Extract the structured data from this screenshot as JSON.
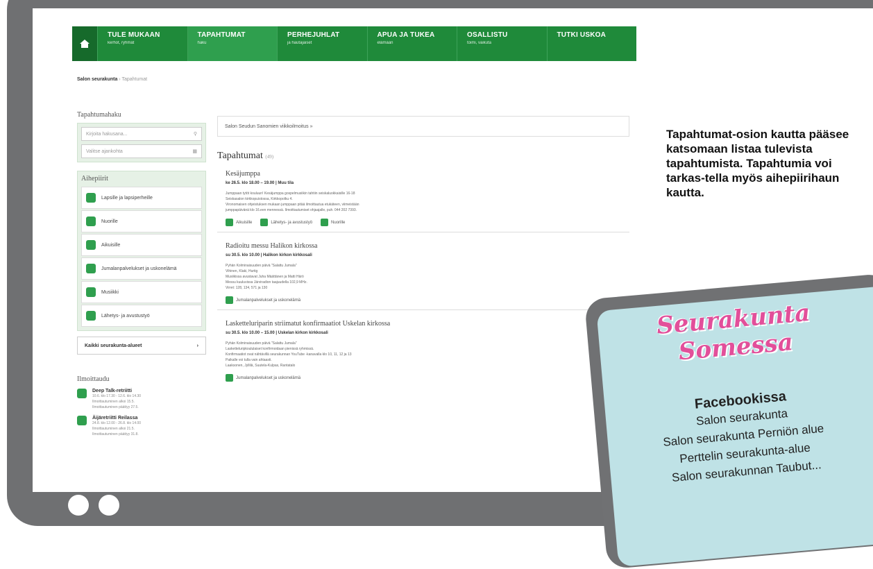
{
  "nav": {
    "items": [
      {
        "title": "TULE MUKAAN",
        "sub": "kerhot, ryhmät"
      },
      {
        "title": "TAPAHTUMAT",
        "sub": "haku"
      },
      {
        "title": "PERHEJUHLAT",
        "sub": "ja hautajaiset"
      },
      {
        "title": "APUA JA TUKEA",
        "sub": "elämään"
      },
      {
        "title": "OSALLISTU",
        "sub": "toimi, vaikuta"
      },
      {
        "title": "TUTKI USKOA",
        "sub": ""
      }
    ]
  },
  "breadcrumb": {
    "root": "Salon seurakunta",
    "current": "Tapahtumat"
  },
  "sidebar": {
    "search_heading": "Tapahtumahaku",
    "search_placeholder": "Kirjoita hakusana...",
    "date_placeholder": "Valitse ajankohta",
    "topics_heading": "Aihepiirit",
    "topics": [
      "Lapsille ja lapsiperheille",
      "Nuorille",
      "Aikuisille",
      "Jumalanpalvelukset ja uskonelämä",
      "Musiikki",
      "Lähetys- ja avustustyö"
    ],
    "all_areas": "Kaikki seurakunta-alueet",
    "register_heading": "Ilmoittaudu",
    "register": [
      {
        "title": "Deep Talk-retriitti",
        "l1": "10.6. klo 17.30 - 12.6. klo 14.30",
        "l2": "Ilmoittautuminen alkoi 15.5.",
        "l3": "Ilmoittautuminen päättyy 27.5."
      },
      {
        "title": "Äijäretriitti Reilassa",
        "l1": "24.8. klo 12.00 - 26.8. klo 14.00",
        "l2": "Ilmoittautuminen alkoi 21.5.",
        "l3": "Ilmoittautuminen päättyy 31.8."
      }
    ]
  },
  "main": {
    "ad": "Salon Seudun Sanomien viikkoilmoitus »",
    "heading": "Tapahtumat",
    "count": "(49)",
    "events": [
      {
        "title": "Kesäjumppa",
        "date": "ke 26.5. klo 18.00 – 19.00",
        "place": "Muu tila",
        "lines": [
          "Jumppaan tytöt kouluun! Kesäjumppa gospelmusiikin tahtiin seiskaluokkaisille 16-18",
          "Seiskasalon kirkkopuistossa, Kirkkopolku 4.",
          "Vironomaisen ohjeistuksen mukaan jumppaan pitää ilmoittautua etukäteen, viimeistään",
          "jumppapäivänä klo 16.een mennessä. Ilmoittautumiset ohjaajalle, puh. 044 202 7393."
        ],
        "tags": [
          "Aikuisille",
          "Lähetys- ja avustustyö",
          "Nuorille"
        ]
      },
      {
        "title": "Radioitu messu Halikon kirkossa",
        "date": "su 30.5. klo 10.00",
        "place": "Halikon kirkon kirkkosali",
        "lines": [
          "Pyhän Kolminaisuuden päivä \"Salattu Jumala\"",
          "Vihinen, Klaki, Hurtig",
          "Musiikissa avustavat Juha Määttänen ja Matti Härö",
          "Messu kuuluvissa Järviradion taajuudella 102,9 MHz.",
          "Virret: 128, 134, 571 ja 130"
        ],
        "tags": [
          "Jumalanpalvelukset ja uskonelämä"
        ]
      },
      {
        "title": "Lasketteluriparin striimatut konfirmaatiot Uskelan kirkossa",
        "date": "su 30.5. klo 10.00 – 15.00",
        "place": "Uskelan kirkon kirkkosali",
        "lines": [
          "Pyhän Kolminaisuuden päivä \"Salattu Jumala\"",
          "Lasketteluripkoululaiset konfirmoidaan pienissä ryhmissä.",
          "Konfirmaatiot ovat nähtävillä seurakunnan YouTube -kanavalla klo 10, 11, 12 ja 13",
          "Paikalle voi tulla vain ahtaasti.",
          "Laaksonen, Jyllilä, Suutela-Kulpas, Rantatalo"
        ],
        "tags": [
          "Jumalanpalvelukset ja uskonelämä"
        ]
      }
    ]
  },
  "caption": "Tapahtumat-osion kautta pääsee katsomaan listaa tulevista tapahtumista. Tapahtumia voi tarkas-tella myös aihepiirihaun kautta.",
  "card": {
    "title1": "Seurakunta",
    "title2": "Somessa",
    "fb_heading": "Facebookissa",
    "fb": [
      "Salon seurakunta",
      "Salon seurakunta Perniön alue",
      "Perttelin seurakunta-alue",
      "Salon seurakunnan Taubut..."
    ]
  },
  "colors": {
    "nav_green": "#1f8a3a",
    "frame_gray": "#6f7072",
    "card_bg": "#bfe2e6",
    "card_title": "#e24f9a"
  }
}
